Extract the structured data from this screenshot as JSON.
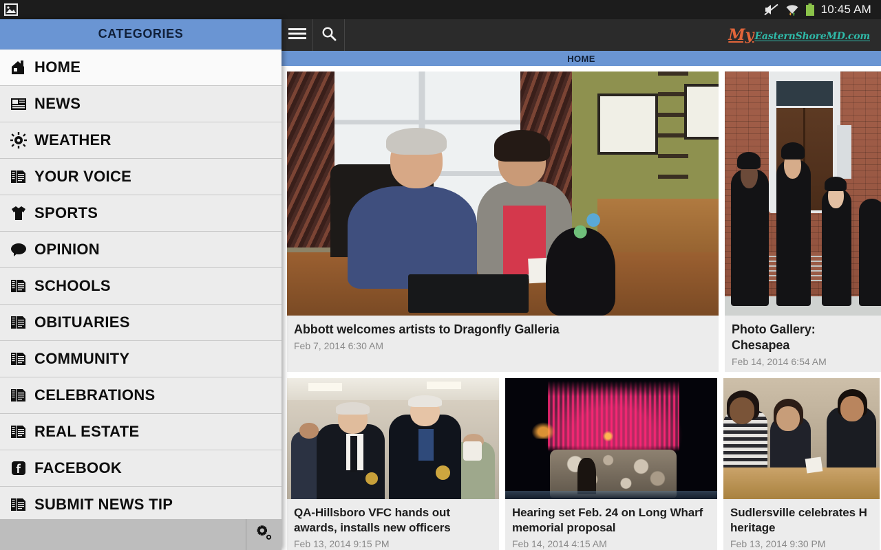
{
  "status_bar": {
    "time": "10:45 AM",
    "icons": [
      "gallery-icon",
      "volume-muted-icon",
      "wifi-icon",
      "battery-icon"
    ]
  },
  "drawer": {
    "header_title": "CATEGORIES",
    "items": [
      {
        "label": "HOME",
        "icon": "home-icon",
        "active": true
      },
      {
        "label": "NEWS",
        "icon": "newspaper-icon",
        "active": false
      },
      {
        "label": "WEATHER",
        "icon": "sun-icon",
        "active": false
      },
      {
        "label": "YOUR VOICE",
        "icon": "documents-icon",
        "active": false
      },
      {
        "label": "SPORTS",
        "icon": "tshirt-icon",
        "active": false
      },
      {
        "label": "OPINION",
        "icon": "speech-bubble-icon",
        "active": false
      },
      {
        "label": "SCHOOLS",
        "icon": "documents-icon",
        "active": false
      },
      {
        "label": "OBITUARIES",
        "icon": "documents-icon",
        "active": false
      },
      {
        "label": "COMMUNITY",
        "icon": "documents-icon",
        "active": false
      },
      {
        "label": "CELEBRATIONS",
        "icon": "documents-icon",
        "active": false
      },
      {
        "label": "REAL ESTATE",
        "icon": "documents-icon",
        "active": false
      },
      {
        "label": "FACEBOOK",
        "icon": "facebook-icon",
        "active": false
      },
      {
        "label": "SUBMIT NEWS TIP",
        "icon": "documents-icon",
        "active": false
      }
    ],
    "settings_icon": "gear-icon"
  },
  "action_bar": {
    "menu_icon": "hamburger-menu-icon",
    "search_icon": "search-icon",
    "logo_primary": "My",
    "logo_secondary": "EasternShoreMD.com"
  },
  "breadcrumb": {
    "label": "HOME"
  },
  "feed": {
    "articles": [
      {
        "title": "Abbott welcomes artists to Dragonfly Galleria",
        "date": "Feb 7, 2014 6:30 AM",
        "photo": "two-women-at-desk-photo"
      },
      {
        "title": "Photo Gallery: Chesapea",
        "date": "Feb 14, 2014 6:54 AM",
        "photo": "group-in-black-uniforms-photo"
      },
      {
        "title": "QA-Hillsboro VFC hands out awards, installs new officers",
        "date": "Feb 13, 2014 9:15 PM",
        "photo": "two-firefighters-photo"
      },
      {
        "title": "Hearing set Feb. 24 on Long Wharf memorial proposal",
        "date": "Feb 14, 2014 4:15 AM",
        "photo": "pink-fountain-night-photo"
      },
      {
        "title": "Sudlersville celebrates H heritage",
        "date": "Feb 13, 2014 9:30 PM",
        "photo": "students-at-table-photo"
      }
    ]
  },
  "colors": {
    "accent_blue": "#6a95d3",
    "status_bar": "#1c1c1c",
    "action_bar": "#2b2b2b",
    "card_bg": "#ececec",
    "logo_orange": "#e2653a",
    "logo_teal": "#2fb9a8"
  }
}
